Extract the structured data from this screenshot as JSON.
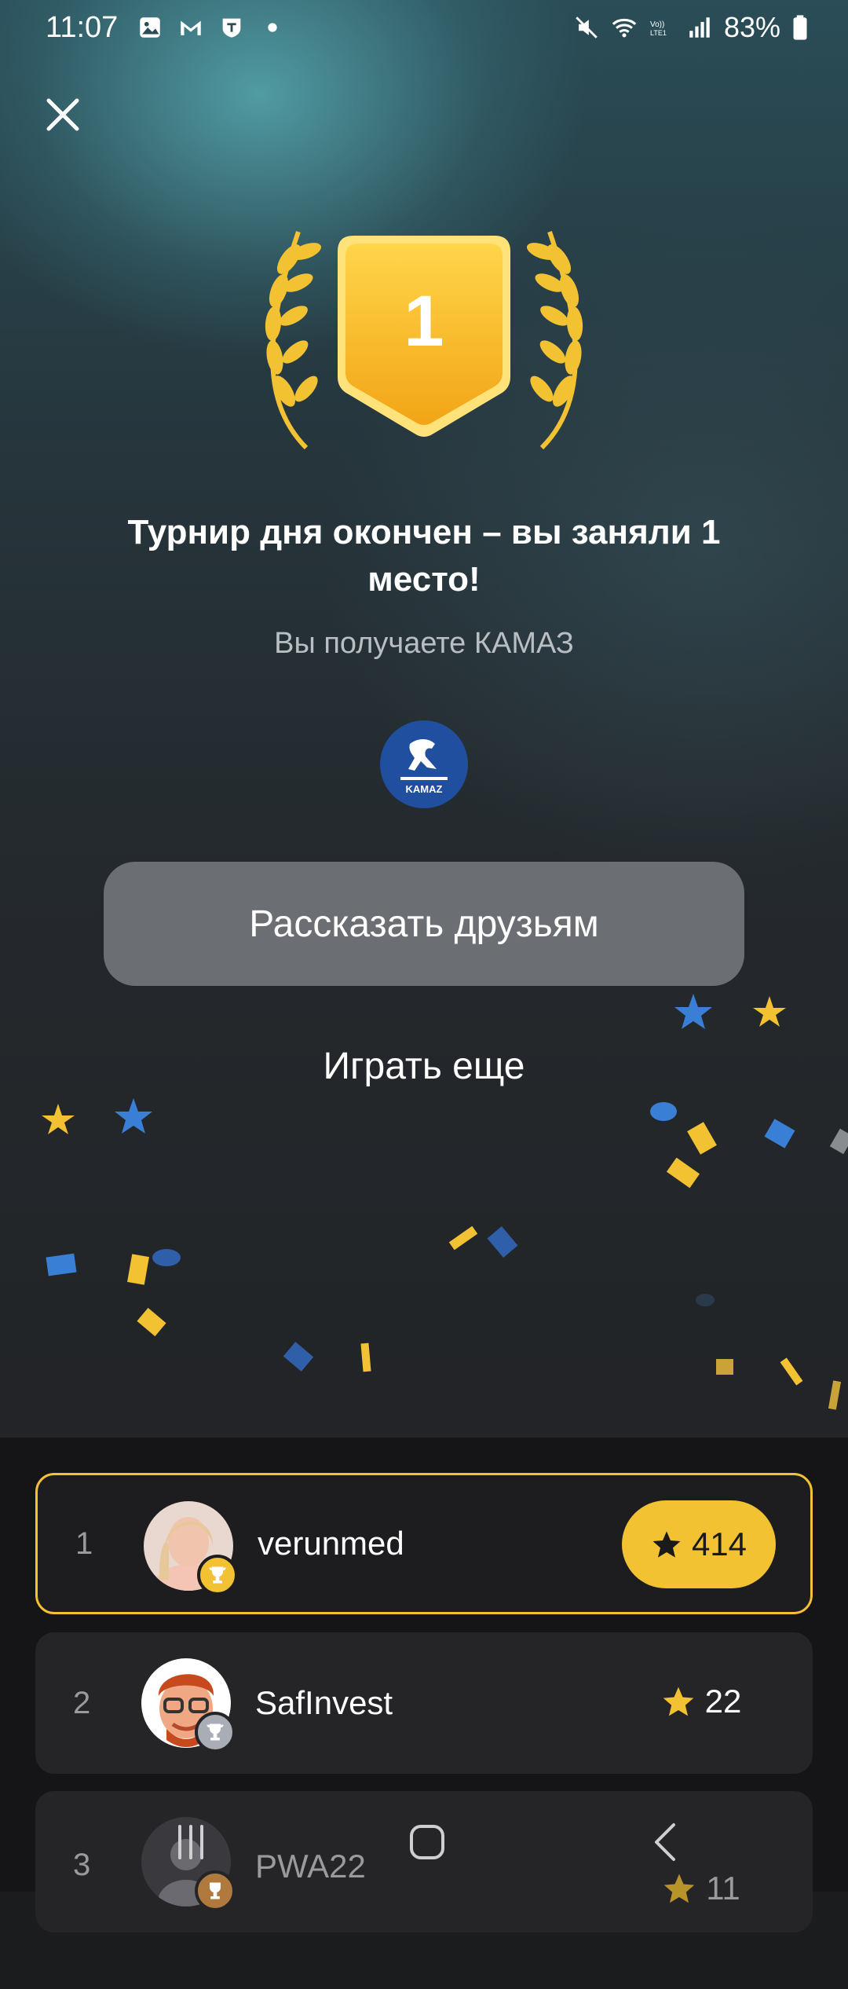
{
  "status_bar": {
    "time": "11:07",
    "battery": "83%",
    "notification_icons": [
      "gallery-icon",
      "gmail-icon",
      "tinkoff-icon",
      "dot-icon"
    ],
    "system_icons": [
      "mute-icon",
      "wifi-icon",
      "volte-icon",
      "signal-icon",
      "battery-icon"
    ]
  },
  "result": {
    "place_badge": "1",
    "title": "Турнир дня окончен – вы заняли 1 место!",
    "subtitle": "Вы получаете КАМАЗ",
    "prize_logo_text": "KAMAZ"
  },
  "actions": {
    "share_label": "Рассказать друзьям",
    "play_again_label": "Играть еще"
  },
  "leaderboard": [
    {
      "rank": "1",
      "username": "verunmed",
      "score": "414",
      "highlight": true,
      "trophy": "gold"
    },
    {
      "rank": "2",
      "username": "SafInvest",
      "score": "22",
      "highlight": false,
      "trophy": "silver"
    },
    {
      "rank": "3",
      "username": "PWA22",
      "score": "11",
      "highlight": false,
      "trophy": "bronze"
    }
  ],
  "colors": {
    "accent_gold": "#f2c233",
    "button_grey": "#6b6e72",
    "kamaz_blue": "#1f4f9e"
  }
}
